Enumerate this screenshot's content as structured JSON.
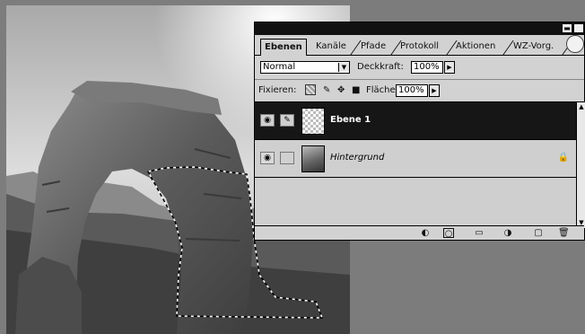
{
  "panel": {
    "tabs": [
      "Ebenen",
      "Kanäle",
      "Pfade",
      "Protokoll",
      "Aktionen",
      "WZ-Vorg."
    ],
    "active_tab": "Ebenen",
    "blend_mode": "Normal",
    "opacity_label": "Deckkraft:",
    "opacity_value": "100%",
    "lock_label": "Fixieren:",
    "fill_label": "Fläche",
    "fill_value": "100%",
    "layers": [
      {
        "name": "Ebene 1",
        "selected": true,
        "visible": true,
        "linked_brush": true
      },
      {
        "name": "Hintergrund",
        "selected": false,
        "visible": true,
        "locked": true
      }
    ]
  },
  "icons": {
    "eye": "eye-icon",
    "brush": "brush-icon",
    "lock": "lock-icon",
    "move": "move-icon",
    "trash": "trash-icon",
    "new_layer": "new-layer-icon",
    "folder": "folder-icon",
    "mask": "mask-icon",
    "adjust": "adjustment-icon",
    "style": "layer-style-icon"
  },
  "colors": {
    "panel_bg": "#d2d2d2",
    "selected_row": "#161616",
    "workspace": "#7c7c7c"
  }
}
